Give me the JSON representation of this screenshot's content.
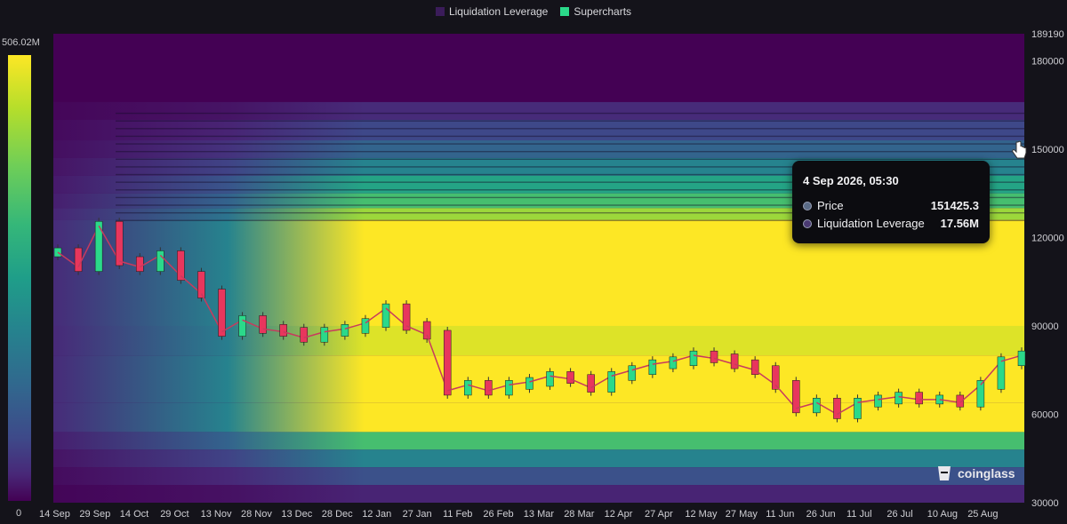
{
  "legend": [
    {
      "label": "Liquidation Leverage",
      "color": "#3b1c5a"
    },
    {
      "label": "Supercharts",
      "color": "#2bd98a"
    }
  ],
  "colorbar": {
    "max_label": "506.02M",
    "min_label": "0"
  },
  "tooltip": {
    "date": "4 Sep 2026, 05:30",
    "rows": [
      {
        "label": "Price",
        "value": "151425.3"
      },
      {
        "label": "Liquidation Leverage",
        "value": "17.56M"
      }
    ]
  },
  "watermark": "coinglass",
  "chart_data": {
    "type": "heatmap",
    "title": "",
    "xlabel": "",
    "ylabel": "",
    "ylim": [
      30000,
      189190
    ],
    "y_ticks": [
      "189190",
      "180000",
      "150000",
      "120000",
      "90000",
      "60000",
      "30000"
    ],
    "x_ticks": [
      "14 Sep",
      "29 Sep",
      "14 Oct",
      "29 Oct",
      "13 Nov",
      "28 Nov",
      "13 Dec",
      "28 Dec",
      "12 Jan",
      "27 Jan",
      "11 Feb",
      "26 Feb",
      "13 Mar",
      "28 Mar",
      "12 Apr",
      "27 Apr",
      "12 May",
      "27 May",
      "11 Jun",
      "26 Jun",
      "11 Jul",
      "26 Jul",
      "10 Aug",
      "25 Aug"
    ],
    "color_scale": {
      "min": 0,
      "max": 506020000,
      "colormap": "viridis"
    },
    "price_series": {
      "name": "Price",
      "x": [
        "14 Sep",
        "21 Sep",
        "29 Sep",
        "6 Oct",
        "14 Oct",
        "21 Oct",
        "29 Oct",
        "6 Nov",
        "13 Nov",
        "21 Nov",
        "28 Nov",
        "6 Dec",
        "13 Dec",
        "21 Dec",
        "28 Dec",
        "5 Jan",
        "12 Jan",
        "20 Jan",
        "27 Jan",
        "4 Feb",
        "11 Feb",
        "19 Feb",
        "26 Feb",
        "6 Mar",
        "13 Mar",
        "21 Mar",
        "28 Mar",
        "5 Apr",
        "12 Apr",
        "20 Apr",
        "27 Apr",
        "5 May",
        "12 May",
        "20 May",
        "27 May",
        "4 Jun",
        "11 Jun",
        "19 Jun",
        "26 Jun",
        "4 Jul",
        "11 Jul",
        "19 Jul",
        "26 Jul",
        "3 Aug",
        "10 Aug",
        "18 Aug",
        "25 Aug",
        "1 Sep"
      ],
      "y": [
        115000,
        110000,
        124000,
        112000,
        110000,
        114000,
        107000,
        101000,
        88000,
        92000,
        89000,
        88000,
        86000,
        88000,
        89000,
        91000,
        96000,
        90000,
        87000,
        68000,
        70000,
        68000,
        70000,
        71000,
        73000,
        72000,
        69000,
        73000,
        75000,
        77000,
        78000,
        80000,
        79000,
        77000,
        75000,
        70000,
        62000,
        64000,
        60000,
        64000,
        65000,
        66000,
        65000,
        65000,
        64000,
        70000,
        78000,
        80000
      ]
    },
    "zones": [
      {
        "y_from": 166000,
        "y_to": 189190,
        "intensity": 0.0
      },
      {
        "y_from": 160000,
        "y_to": 166000,
        "intensity": 0.12
      },
      {
        "y_from": 153000,
        "y_to": 160000,
        "intensity": 0.22
      },
      {
        "y_from": 147000,
        "y_to": 153000,
        "intensity": 0.32
      },
      {
        "y_from": 141000,
        "y_to": 147000,
        "intensity": 0.45
      },
      {
        "y_from": 135000,
        "y_to": 141000,
        "intensity": 0.58
      },
      {
        "y_from": 130000,
        "y_to": 135000,
        "intensity": 0.7
      },
      {
        "y_from": 126000,
        "y_to": 130000,
        "intensity": 0.85
      },
      {
        "y_from": 90000,
        "y_to": 126000,
        "intensity": 1.0
      },
      {
        "y_from": 80000,
        "y_to": 90000,
        "intensity": 0.95
      },
      {
        "y_from": 64000,
        "y_to": 80000,
        "intensity": 1.0
      },
      {
        "y_from": 54000,
        "y_to": 64000,
        "intensity": 1.0
      },
      {
        "y_from": 48000,
        "y_to": 54000,
        "intensity": 0.7
      },
      {
        "y_from": 42000,
        "y_to": 48000,
        "intensity": 0.45
      },
      {
        "y_from": 36000,
        "y_to": 42000,
        "intensity": 0.25
      },
      {
        "y_from": 30000,
        "y_to": 36000,
        "intensity": 0.1
      }
    ],
    "colors": {
      "low": "#440154",
      "mid": "#21918c",
      "high": "#fde725",
      "candle_up": "#2bd98a",
      "candle_down": "#e8365d"
    }
  }
}
